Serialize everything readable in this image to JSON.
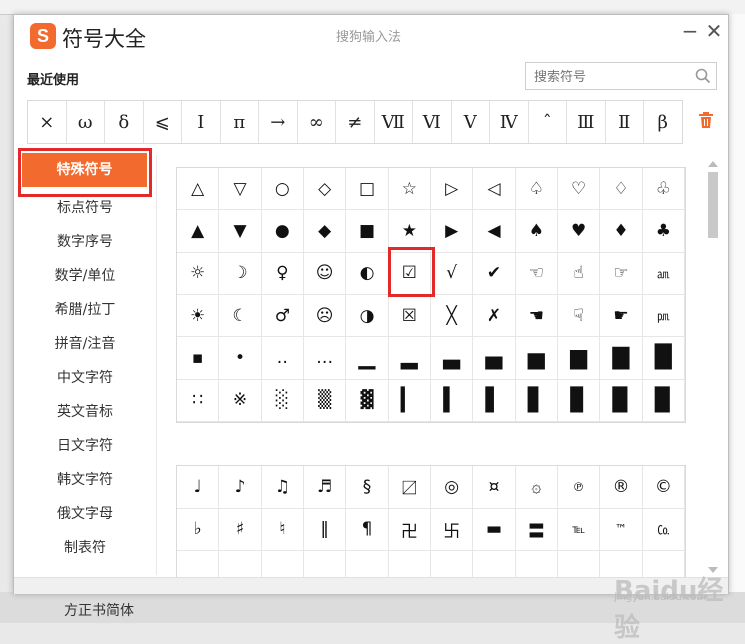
{
  "window": {
    "title": "符号大全",
    "center_title": "搜狗输入法",
    "minimize": "−",
    "close": "✕"
  },
  "recent": {
    "label": "最近使用",
    "symbols": [
      "×",
      "ω",
      "δ",
      "⩽",
      "Ⅰ",
      "π",
      "→",
      "∞",
      "≠",
      "Ⅶ",
      "Ⅵ",
      "Ⅴ",
      "Ⅳ",
      "ˆ",
      "Ⅲ",
      "Ⅱ",
      "β"
    ]
  },
  "search": {
    "placeholder": "搜索符号"
  },
  "sidebar": {
    "items": [
      {
        "label": "特殊符号"
      },
      {
        "label": "标点符号"
      },
      {
        "label": "数字序号"
      },
      {
        "label": "数学/单位"
      },
      {
        "label": "希腊/拉丁"
      },
      {
        "label": "拼音/注音"
      },
      {
        "label": "中文字符"
      },
      {
        "label": "英文音标"
      },
      {
        "label": "日文字符"
      },
      {
        "label": "韩文字符"
      },
      {
        "label": "俄文字母"
      },
      {
        "label": "制表符"
      }
    ]
  },
  "grid1": [
    [
      "△",
      "▽",
      "○",
      "◇",
      "□",
      "☆",
      "▷",
      "◁",
      "♤",
      "♡",
      "♢",
      "♧"
    ],
    [
      "▲",
      "▼",
      "●",
      "◆",
      "■",
      "★",
      "▶",
      "◀",
      "♠",
      "♥",
      "♦",
      "♣"
    ],
    [
      "☼",
      "☽",
      "♀",
      "☺",
      "◐",
      "☑",
      "√",
      "✔",
      "☜",
      "☝",
      "☞",
      "㏂"
    ],
    [
      "☀",
      "☾",
      "♂",
      "☹",
      "◑",
      "☒",
      "╳",
      "✗",
      "☚",
      "☟",
      "☛",
      "㏘"
    ],
    [
      "▪",
      "•",
      "‥",
      "…",
      "▁",
      "▂",
      "▃",
      "▄",
      "▅",
      "▆",
      "▇",
      "█"
    ],
    [
      "∷",
      "※",
      "░",
      "▒",
      "▓",
      "▎",
      "▍",
      "▌",
      "▋",
      "▊",
      "▉",
      "▉"
    ]
  ],
  "grid2": [
    [
      "♩",
      "♪",
      "♫",
      "♬",
      "§",
      "〼",
      "◎",
      "¤",
      "۞",
      "℗",
      "®",
      "©"
    ],
    [
      "♭",
      "♯",
      "♮",
      "‖",
      "¶",
      "卍",
      "卐",
      "▬",
      "〓",
      "℡",
      "™",
      "㏇"
    ],
    [
      "",
      "",
      "",
      "",
      "",
      "",
      "",
      "",
      "",
      "",
      "",
      ""
    ]
  ],
  "background": {
    "bottom_text": "方正书简体"
  },
  "watermark": {
    "text": "Baidu经验",
    "sub": "jingyan.baidu.com"
  },
  "colors": {
    "accent": "#f26a2d",
    "highlight": "#e32a2a"
  }
}
